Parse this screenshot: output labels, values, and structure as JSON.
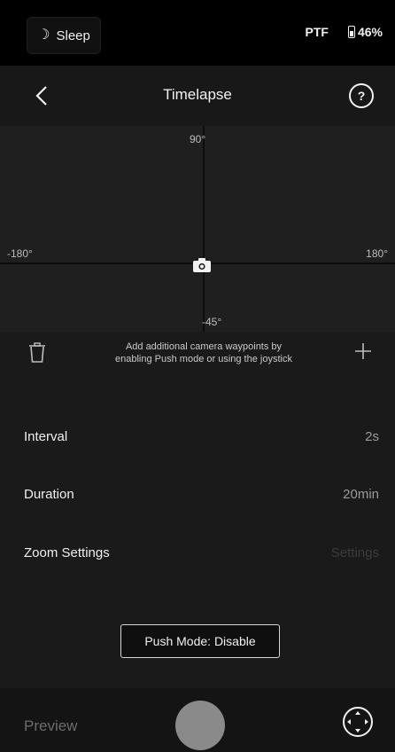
{
  "status": {
    "sleep_label": "Sleep",
    "mode": "PTF",
    "battery": "46%"
  },
  "header": {
    "title": "Timelapse"
  },
  "waypoint_map": {
    "top_label": "90°",
    "left_label": "-180°",
    "right_label": "180°",
    "bottom_label": "-45°"
  },
  "waypoint_toolbar": {
    "hint_line1": "Add additional camera waypoints by",
    "hint_line2": "enabling Push mode or using the joystick"
  },
  "settings": {
    "interval_label": "Interval",
    "interval_value": "2s",
    "duration_label": "Duration",
    "duration_value": "20min",
    "zoom_label": "Zoom Settings",
    "zoom_value": "Settings"
  },
  "push_mode_label": "Push Mode: Disable",
  "bottom": {
    "preview_label": "Preview"
  },
  "colors": {
    "background": "#000000",
    "panel": "#1a1a1a",
    "shutter": "#8a8a8a"
  }
}
